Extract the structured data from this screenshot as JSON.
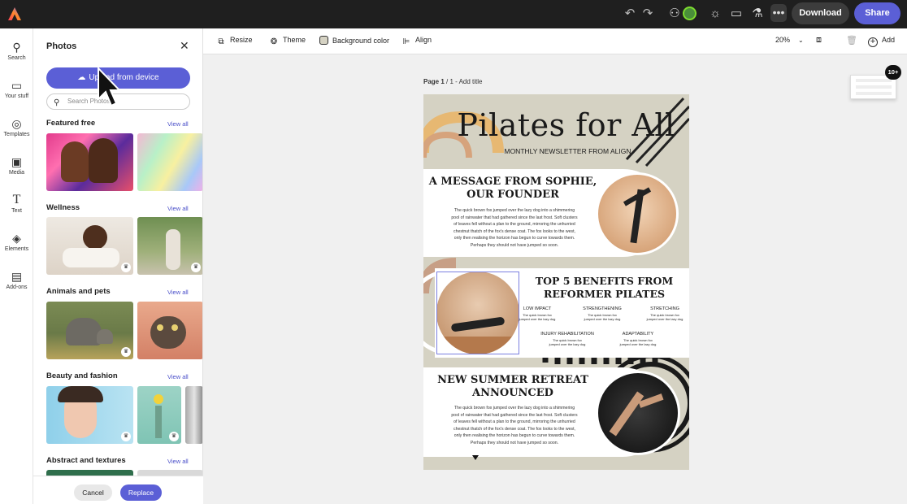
{
  "topbar": {
    "download_label": "Download",
    "share_label": "Share",
    "more_label": "•••"
  },
  "rail": [
    {
      "label": "Search",
      "icon": "search-icon"
    },
    {
      "label": "Your stuff",
      "icon": "folder-icon"
    },
    {
      "label": "Templates",
      "icon": "templates-icon"
    },
    {
      "label": "Media",
      "icon": "media-icon"
    },
    {
      "label": "Text",
      "icon": "text-icon"
    },
    {
      "label": "Elements",
      "icon": "elements-icon"
    },
    {
      "label": "Add-ons",
      "icon": "addons-icon"
    }
  ],
  "panel": {
    "title": "Photos",
    "upload_label": "Upload from device",
    "search_placeholder": "Search Photos",
    "view_all": "View all",
    "sections": [
      {
        "title": "Featured free"
      },
      {
        "title": "Wellness"
      },
      {
        "title": "Animals and pets"
      },
      {
        "title": "Beauty and fashion"
      },
      {
        "title": "Abstract and textures"
      }
    ],
    "cancel_label": "Cancel",
    "replace_label": "Replace"
  },
  "toolbar": {
    "resize": "Resize",
    "theme": "Theme",
    "background_color": "Background color",
    "align": "Align",
    "zoom": "20%",
    "add": "Add",
    "badge": "10+"
  },
  "canvas": {
    "page_label_bold": "Page 1",
    "page_label_rest": " / 1 - Add title"
  },
  "newsletter": {
    "title": "Pilates for All",
    "subtitle": "MONTHLY NEWSLETTER FROM ALIGN",
    "section1_heading_1": "A MESSAGE FROM SOPHIE,",
    "section1_heading_2": "OUR FOUNDER",
    "body_lines": [
      "The quick brown fox jumped over the lazy dog into a shimmering",
      "pool of rainwater that had gathered since the last frost. Soft clusters",
      "of leaves fell without a plan to the ground, mirroring the unhurried",
      "chestnut thatch of the fox's dense coat. The fox looks to the west,",
      "only then realising the horizon has begun to curve towards them.",
      "Perhaps they should not have jumped so soon."
    ],
    "section2_heading_1": "TOP 5 BENEFITS FROM",
    "section2_heading_2": "REFORMER PILATES",
    "benefits": [
      "LOW IMPACT",
      "STRENGTHENING",
      "STRETCHING",
      "INJURY REHABILITATION",
      "ADAPTABILITY"
    ],
    "benefit_text_1": "The quick brown fox",
    "benefit_text_2": "jumped over the lazy dog",
    "section3_heading_1": "NEW SUMMER RETREAT",
    "section3_heading_2": "ANNOUNCED"
  }
}
